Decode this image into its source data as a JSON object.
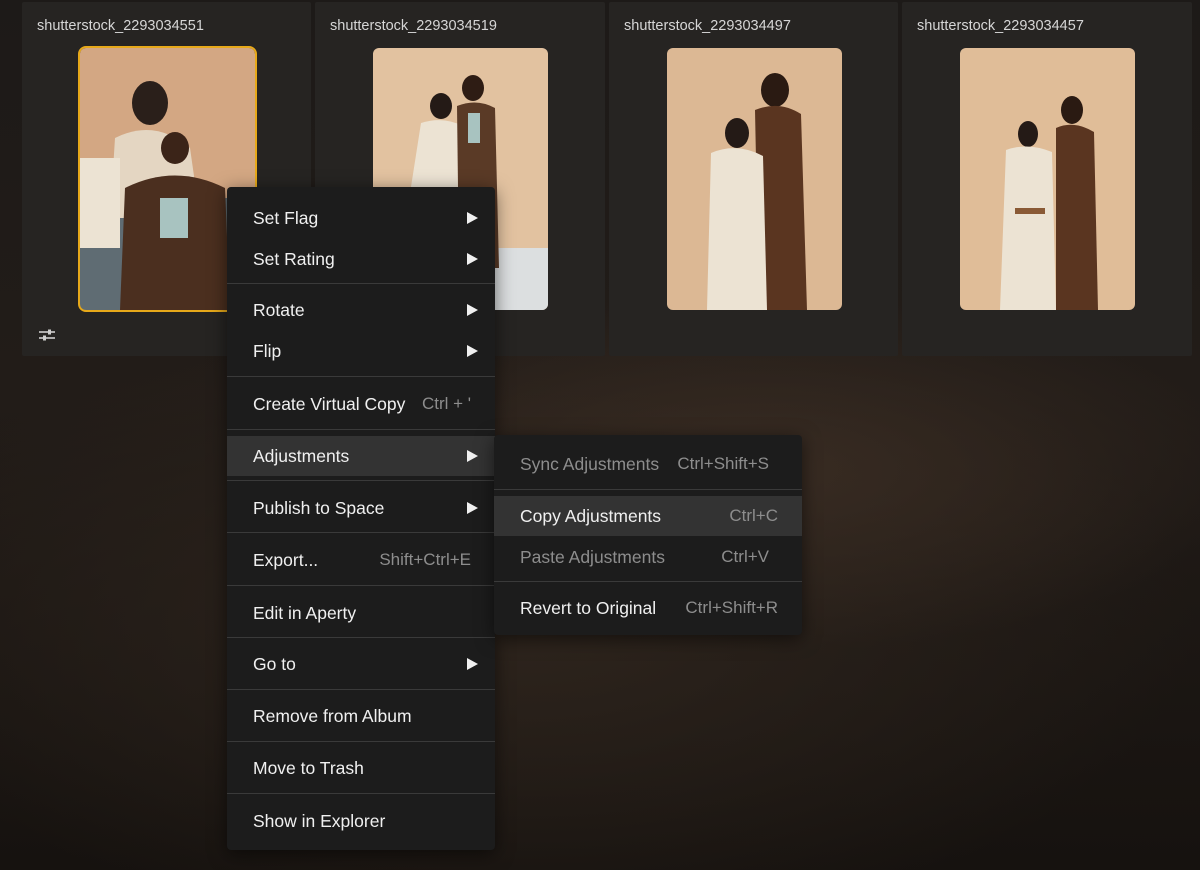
{
  "grid": {
    "tiles": [
      {
        "name": "shutterstock_2293034551",
        "selected": true,
        "has_adjustments": true
      },
      {
        "name": "shutterstock_2293034519",
        "selected": false,
        "has_adjustments": false
      },
      {
        "name": "shutterstock_2293034497",
        "selected": false,
        "has_adjustments": false
      },
      {
        "name": "shutterstock_2293034457",
        "selected": false,
        "has_adjustments": false
      }
    ],
    "selection_color": "#e7a91a"
  },
  "context_menu": {
    "items": [
      {
        "label": "Set Flag",
        "submenu": true
      },
      {
        "label": "Set Rating",
        "submenu": true
      },
      {
        "label": "Rotate",
        "submenu": true
      },
      {
        "label": "Flip",
        "submenu": true
      },
      {
        "label": "Create Virtual Copy",
        "shortcut": "Ctrl + '"
      },
      {
        "label": "Adjustments",
        "submenu": true,
        "active": true
      },
      {
        "label": "Publish to Space",
        "submenu": true
      },
      {
        "label": "Export...",
        "shortcut": "Shift+Ctrl+E"
      },
      {
        "label": "Edit in Aperty"
      },
      {
        "label": "Go to",
        "submenu": true
      },
      {
        "label": "Remove from Album"
      },
      {
        "label": "Move to Trash"
      },
      {
        "label": "Show in Explorer"
      }
    ]
  },
  "submenu": {
    "items": [
      {
        "label": "Sync Adjustments",
        "shortcut": "Ctrl+Shift+S",
        "disabled": true
      },
      {
        "label": "Copy Adjustments",
        "shortcut": "Ctrl+C",
        "hovered": true
      },
      {
        "label": "Paste Adjustments",
        "shortcut": "Ctrl+V",
        "disabled": true
      },
      {
        "label": "Revert to Original",
        "shortcut": "Ctrl+Shift+R"
      }
    ]
  }
}
